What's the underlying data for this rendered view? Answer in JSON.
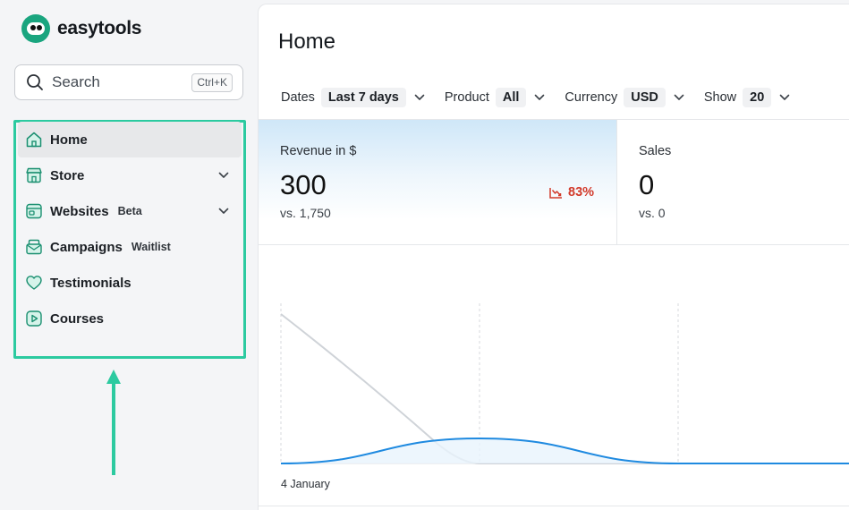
{
  "app": {
    "name": "easytools"
  },
  "search": {
    "label": "Search",
    "shortcut": "Ctrl+K"
  },
  "sidebar": {
    "items": [
      {
        "label": "Home",
        "icon": "home-icon",
        "badge": "",
        "expandable": false,
        "active": true
      },
      {
        "label": "Store",
        "icon": "store-icon",
        "badge": "",
        "expandable": true,
        "active": false
      },
      {
        "label": "Websites",
        "icon": "websites-icon",
        "badge": "Beta",
        "expandable": true,
        "active": false
      },
      {
        "label": "Campaigns",
        "icon": "campaigns-icon",
        "badge": "Waitlist",
        "expandable": false,
        "active": false
      },
      {
        "label": "Testimonials",
        "icon": "heart-icon",
        "badge": "",
        "expandable": false,
        "active": false
      },
      {
        "label": "Courses",
        "icon": "play-icon",
        "badge": "",
        "expandable": false,
        "active": false
      }
    ]
  },
  "main": {
    "title": "Home",
    "filters": [
      {
        "label": "Dates",
        "value": "Last 7 days"
      },
      {
        "label": "Product",
        "value": "All"
      },
      {
        "label": "Currency",
        "value": "USD"
      },
      {
        "label": "Show",
        "value": "20"
      }
    ],
    "cards": {
      "revenue": {
        "label": "Revenue in $",
        "value": "300",
        "comparison": "vs. 1,750",
        "change": "83%",
        "trend": "down"
      },
      "sales": {
        "label": "Sales",
        "value": "0",
        "comparison": "vs. 0"
      }
    },
    "chart": {
      "x_label": "4 January"
    }
  },
  "colors": {
    "accent": "#2ccaa0",
    "brand": "#1aa57f",
    "negative": "#d23a2b",
    "current_series": "#1f8ae0",
    "previous_series": "#cfd3d8"
  },
  "chart_data": {
    "type": "line",
    "x": [
      "4 January",
      "",
      "",
      ""
    ],
    "series": [
      {
        "values": [
          0,
          2,
          0,
          0
        ]
      },
      {
        "values": [
          12,
          0,
          0,
          0
        ]
      }
    ]
  }
}
